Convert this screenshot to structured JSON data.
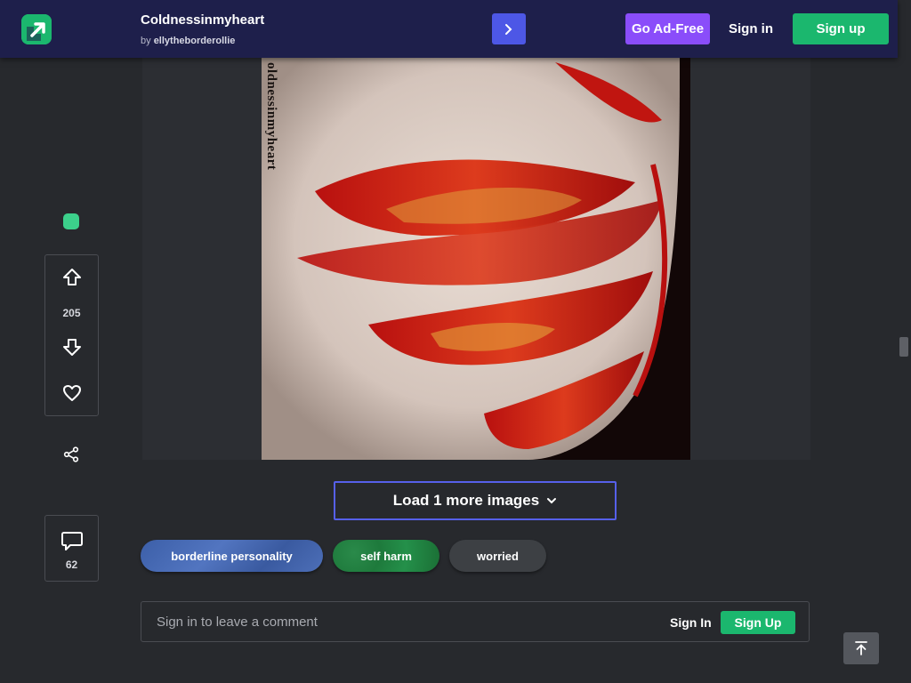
{
  "header": {
    "title": "Coldnessinmyheart",
    "by_prefix": "by",
    "author": "ellytheborderollie",
    "go_ad_free": "Go Ad-Free",
    "sign_in": "Sign in",
    "sign_up": "Sign up"
  },
  "post": {
    "image_watermark": "oldnessinmyheart",
    "upvotes": "205",
    "comments": "62"
  },
  "load_more": "Load 1 more images",
  "tags": [
    "borderline personality",
    "self harm",
    "worried"
  ],
  "comment": {
    "placeholder": "Sign in to leave a comment",
    "sign_in": "Sign In",
    "sign_up": "Sign Up"
  },
  "colors": {
    "accent": "#4d57e6",
    "ad_free": "#8a4dfa",
    "signup": "#1bb76e",
    "header_bg": "#1e1f4b",
    "page_bg": "#27292d"
  }
}
